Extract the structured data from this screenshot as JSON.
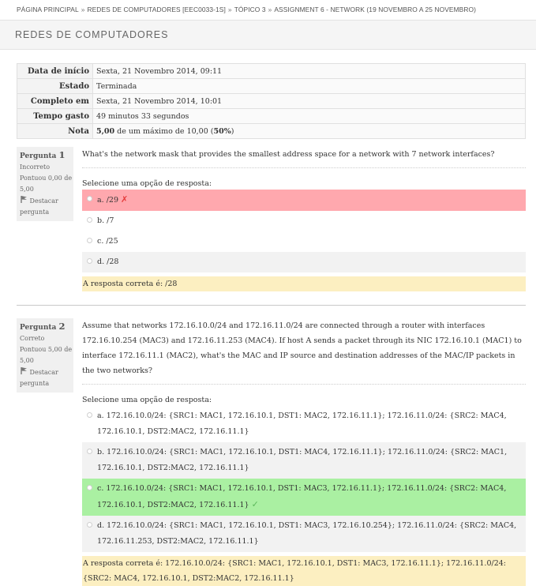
{
  "breadcrumb": {
    "items": [
      "PÁGINA PRINCIPAL",
      "REDES DE COMPUTADORES [EEC0033-1S]",
      "TÓPICO 3",
      "ASSIGNMENT 6 - NETWORK (19 NOVEMBRO A 25 NOVEMBRO)"
    ],
    "separator": "»"
  },
  "header": {
    "title": "REDES DE COMPUTADORES"
  },
  "summary": [
    {
      "label": "Data de início",
      "value": "Sexta, 21 Novembro 2014, 09:11"
    },
    {
      "label": "Estado",
      "value": "Terminada"
    },
    {
      "label": "Completo em",
      "value": "Sexta, 21 Novembro 2014, 10:01"
    },
    {
      "label": "Tempo gasto",
      "value": "49 minutos 33 segundos"
    },
    {
      "label": "Nota",
      "value_bold": "5,00",
      "value_rest": " de um máximo de 10,00 (",
      "value_pct": "50%",
      "value_end": ")"
    }
  ],
  "questions": [
    {
      "label": "Pergunta",
      "number": "1",
      "state": "Incorreto",
      "grade": "Pontuou 0,00 de 5,00",
      "flag_label": "Destacar pergunta",
      "text": "What's the network mask that provides the smallest address space for a network with 7 network interfaces?",
      "prompt": "Selecione uma opção de resposta:",
      "options": [
        "a. /29",
        "b. /7",
        "c. /25",
        "d. /28"
      ],
      "feedback": "A resposta correta é: /28"
    },
    {
      "label": "Pergunta",
      "number": "2",
      "state": "Correto",
      "grade": "Pontuou 5,00 de 5,00",
      "flag_label": "Destacar pergunta",
      "text": "Assume that networks 172.16.10.0/24 and 172.16.11.0/24 are connected through a router with interfaces 172.16.10.254 (MAC3) and 172.16.11.253 (MAC4). If host A sends a packet through its NIC 172.16.10.1 (MAC1) to interface 172.16.11.1 (MAC2), what's the MAC and IP source and destination addresses of the MAC/IP packets in the two networks?",
      "prompt": "Selecione uma opção de resposta:",
      "options": [
        "a. 172.16.10.0/24: {SRC1: MAC1, 172.16.10.1, DST1: MAC2, 172.16.11.1}; 172.16.11.0/24: {SRC2: MAC4, 172.16.10.1, DST2:MAC2, 172.16.11.1}",
        "b. 172.16.10.0/24: {SRC1: MAC1, 172.16.10.1, DST1: MAC4, 172.16.11.1}; 172.16.11.0/24: {SRC2: MAC1, 172.16.10.1, DST2:MAC2, 172.16.11.1}",
        "c. 172.16.10.0/24: {SRC1: MAC1, 172.16.10.1, DST1: MAC3, 172.16.11.1}; 172.16.11.0/24: {SRC2: MAC4, 172.16.10.1, DST2:MAC2, 172.16.11.1}",
        "d. 172.16.10.0/24: {SRC1: MAC1, 172.16.10.1, DST1: MAC3, 172.16.10.254}; 172.16.11.0/24: {SRC2: MAC4, 172.16.11.253, DST2:MAC2, 172.16.11.1}"
      ],
      "feedback": "A resposta correta é: 172.16.10.0/24: {SRC1: MAC1, 172.16.10.1, DST1: MAC3, 172.16.11.1}; 172.16.11.0/24: {SRC2: MAC4, 172.16.10.1, DST2:MAC2, 172.16.11.1}"
    }
  ],
  "icons": {
    "flag": "flag-icon",
    "wrong": "cross-icon",
    "correct": "check-icon"
  },
  "colors": {
    "wrong_bg": "#ffa8ae",
    "correct_bg": "#aaf0a2",
    "feedback_bg": "#fcefc1"
  }
}
